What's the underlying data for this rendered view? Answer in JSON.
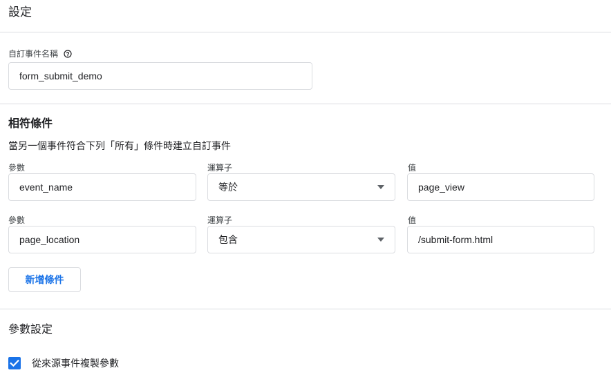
{
  "page": {
    "title": "設定"
  },
  "event_name": {
    "label": "自訂事件名稱",
    "value": "form_submit_demo"
  },
  "matching": {
    "title": "相符條件",
    "subtitle": "當另一個事件符合下列「所有」條件時建立自訂事件",
    "conditions": [
      {
        "param_label": "參數",
        "param_value": "event_name",
        "operator_label": "運算子",
        "operator_value": "等於",
        "value_label": "值",
        "value": "page_view"
      },
      {
        "param_label": "參數",
        "param_value": "page_location",
        "operator_label": "運算子",
        "operator_value": "包含",
        "value_label": "值",
        "value": "/submit-form.html"
      }
    ],
    "add_button": "新增條件"
  },
  "params": {
    "title": "參數設定",
    "copy_checkbox": {
      "label": "從來源事件複製參數",
      "checked": true
    }
  },
  "colors": {
    "accent": "#1a73e8",
    "border": "#dadce0",
    "text": "#202124"
  },
  "icons": {
    "help": "help-circle-icon",
    "dropdown": "caret-down-icon",
    "check": "check-icon"
  }
}
